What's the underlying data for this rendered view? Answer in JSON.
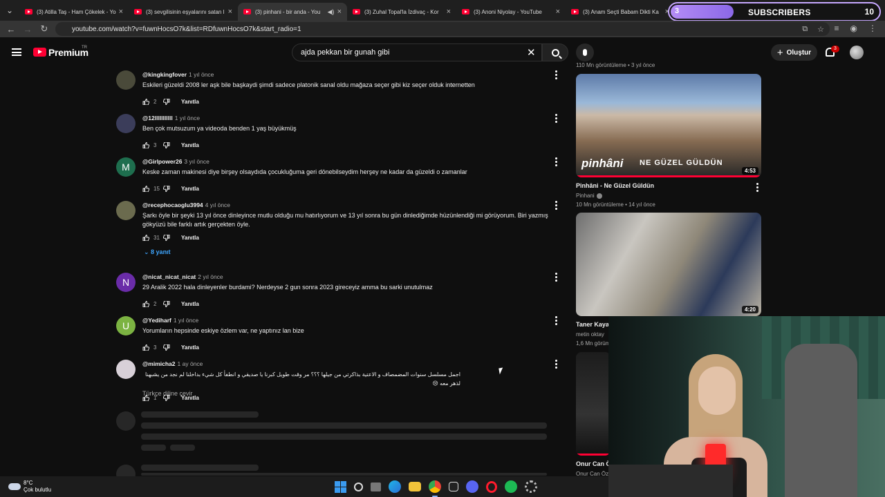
{
  "browser": {
    "tabs": [
      {
        "label": "(3) Atilla Taş - Ham Çökelek - Yo"
      },
      {
        "label": "(3) sevgilisinin eşyalarını satan l"
      },
      {
        "label": "(3) pinhani - bir anda - You"
      },
      {
        "label": "(3) Zuhal Topal'la İzdivaç - Kor"
      },
      {
        "label": "(3) Anoni Niyolay - YouTube"
      },
      {
        "label": "(3) Anam Seçti Babam Dikti Ka"
      }
    ],
    "url": "youtube.com/watch?v=fuwnHocsO7k&list=RDfuwnHocsO7k&start_radio=1"
  },
  "overlay": {
    "sub_current": "3",
    "sub_label": "SUBSCRIBERS",
    "sub_goal": "10",
    "progress": 0.3
  },
  "youtube": {
    "brand": "Premium",
    "country": "TR",
    "search_value": "ajda pekkan bir gunah gibi",
    "create_label": "Oluştur",
    "notif_count": "3"
  },
  "comments": [
    {
      "author": "@kingkingfover",
      "time": "1 yıl önce",
      "text": "Eskileri güzeldi 2008 ler aşk bile başkaydi şimdi sadece platonik sanal oldu mağaza seçer gibi kiz seçer olduk internetten",
      "likes": "2",
      "reply": "Yanıtla",
      "avatar": "",
      "avatar_color": "#4a4a3a"
    },
    {
      "author": "@12lllllllllll",
      "time": "1 yıl önce",
      "text": "Ben çok mutsuzum ya videoda benden 1 yaş büyükmüş",
      "likes": "3",
      "reply": "Yanıtla",
      "avatar": "",
      "avatar_color": "#3b3d5a"
    },
    {
      "author": "@Girlpower26",
      "time": "3 yıl önce",
      "text": "Keske zaman makinesi diye birşey olsaydıda çocukluğuma geri dönebilseydim herşey ne kadar da güzeldi o zamanlar",
      "likes": "15",
      "reply": "Yanıtla",
      "avatar": "M",
      "avatar_color": "#1e6e4e"
    },
    {
      "author": "@recephocaoglu3994",
      "time": "4 yıl önce",
      "text": "Şarkı öyle bir şeyki 13 yıl önce dinleyince mutlu olduğu mu hatırlıyorum ve 13 yıl sonra bu gün dinlediğimde hüzünlendiği mi görüyorum. Biri yazmış gökyüzü bile farklı artık gerçekten öyle.",
      "likes": "31",
      "reply": "Yanıtla",
      "avatar": "",
      "avatar_color": "#6b6b4e"
    },
    {
      "author": "@nicat_nicat_nicat",
      "time": "2 yıl önce",
      "text": "29 Aralik 2022 hala dinleyenler burdami? Nerdeyse 2 gun sonra 2023 gireceyiz  amma bu sarki unutulmaz",
      "likes": "2",
      "reply": "Yanıtla",
      "avatar": "N",
      "avatar_color": "#6a2ca8"
    },
    {
      "author": "@Yediharf",
      "time": "1 yıl önce",
      "text": "Yorumların hepsinde eskiye özlem var, ne yaptınız lan bize",
      "likes": "3",
      "reply": "Yanıtla",
      "avatar": "U",
      "avatar_color": "#7cb342"
    },
    {
      "author": "@mimicha2",
      "time": "1 ay önce",
      "text": "اجمل مسلسل سنوات المضمصاف و الاعتية بذاكرتي من جيلها ؟؟؟ مر وقت طويل كبرنا يا صديقي و انطفأ كل شيء بداخلنا لم نجد من يشبهنا لذهر معه 😢",
      "translate": "Türkçe diline çevir",
      "likes": "1",
      "reply": "Yanıtla",
      "avatar": "",
      "avatar_color": "#d8d0d8"
    }
  ],
  "replies_toggle": "8 yanıt",
  "related": {
    "top_meta": "110 Mn görüntüleme • 3 yıl önce",
    "videos": [
      {
        "title": "Pinhâni - Ne Güzel Güldün",
        "channel": "Pinhani",
        "meta": "10 Mn görüntüleme • 14 yıl önce",
        "duration": "4:53",
        "thumb_logo": "pinhâni",
        "thumb_text": "NE GÜZEL GÜLDÜN"
      },
      {
        "title": "Taner Kaya",
        "channel": "metin oktay",
        "meta": "1,6 Mn görüm",
        "duration": "4:20"
      },
      {
        "title": "Onur Can Ö",
        "channel": "Onur Can Özc"
      }
    ]
  },
  "taskbar": {
    "temp": "8°C",
    "weather": "Çok bulutlu"
  }
}
